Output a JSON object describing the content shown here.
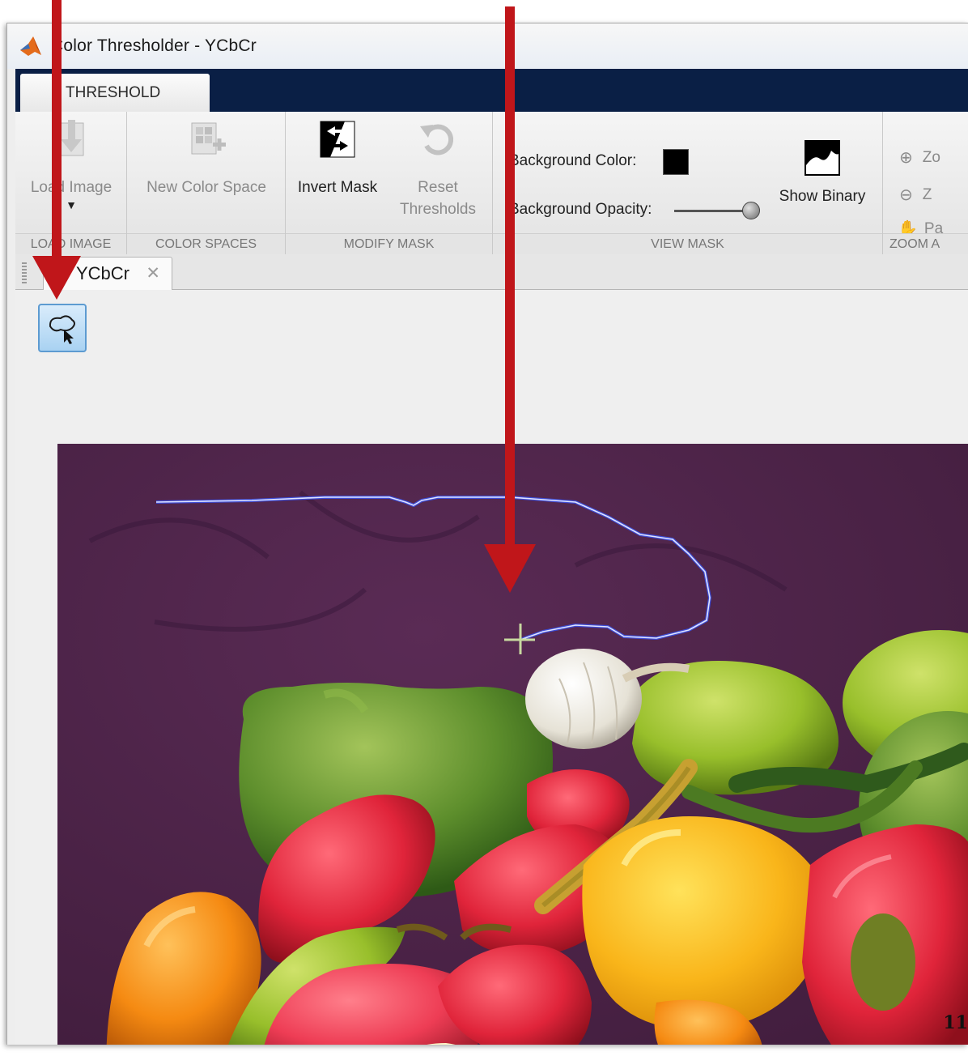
{
  "window": {
    "title": "Color Thresholder - YCbCr"
  },
  "ribbon": {
    "active_tab": "THRESHOLD",
    "load_image": {
      "label": "Load Image",
      "section": "LOAD IMAGE"
    },
    "new_color_space": {
      "label": "New Color Space",
      "section": "COLOR SPACES"
    },
    "invert_mask": {
      "label": "Invert Mask"
    },
    "reset_thresholds": {
      "line1": "Reset",
      "line2": "Thresholds"
    },
    "modify_mask_section": "MODIFY MASK",
    "background_color_label": "Background Color:",
    "background_color": "#000000",
    "background_opacity_label": "Background Opacity:",
    "background_opacity": 1.0,
    "show_binary": "Show Binary",
    "view_mask_section": "VIEW MASK",
    "zoom_in": "Zo",
    "zoom_out": "Z",
    "pan": "Pa",
    "zoom_section": "ZOOM A"
  },
  "document": {
    "tab_label": "YCbCr",
    "lasso_tool": "freehand-roi-icon"
  },
  "colors": {
    "toolstrip_dark": "#0a1f45",
    "image_background": "#4e2548",
    "annotation_arrow": "#c0161a"
  },
  "page_number": "11"
}
